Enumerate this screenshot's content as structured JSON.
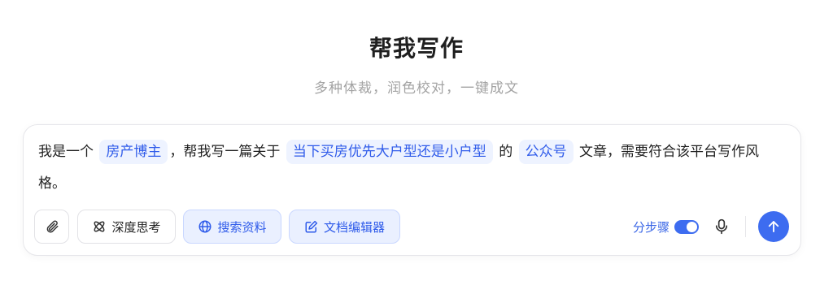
{
  "header": {
    "title": "帮我写作",
    "subtitle": "多种体裁，润色校对，一键成文"
  },
  "prompt": {
    "segments": [
      {
        "text": "我是一个 ",
        "slot": false
      },
      {
        "text": "房产博主",
        "slot": true
      },
      {
        "text": "，帮我写一篇关于 ",
        "slot": false
      },
      {
        "text": "当下买房优先大户型还是小户型",
        "slot": true
      },
      {
        "text": " 的 ",
        "slot": false
      },
      {
        "text": "公众号",
        "slot": true
      },
      {
        "text": " 文章，需要符合该平台写作风格。",
        "slot": false
      }
    ]
  },
  "toolbar": {
    "attach_icon": "paperclip-icon",
    "deep_think_label": "深度思考",
    "search_label": "搜索资料",
    "doc_editor_label": "文档编辑器",
    "steps_label": "分步骤",
    "steps_enabled": true,
    "mic_icon": "microphone-icon",
    "send_icon": "arrow-up-icon"
  },
  "colors": {
    "accent": "#3d6cf0",
    "slot_bg": "#eef3ff",
    "slot_text": "#2f5bea",
    "subtitle": "#a3a3a3"
  }
}
